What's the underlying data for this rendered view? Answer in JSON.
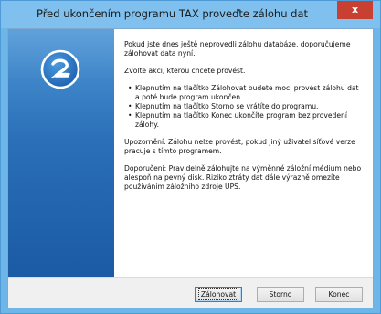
{
  "window": {
    "title": "Před ukončením programu TAX proveďte zálohu dat",
    "close_label": "x"
  },
  "sidebar": {
    "logo_icon": "tax-program-logo-icon"
  },
  "message": {
    "intro": "Pokud jste dnes ještě neprovedli zálohu databáze, doporučujeme zálohovat data nyní.",
    "choose": "Zvolte akci, kterou chcete provést.",
    "options": [
      "Klepnutím na tlačítko Zálohovat budete moci provést zálohu dat a poté bude program ukončen.",
      "Klepnutím na tlačítko Storno se vrátíte do programu.",
      "Klepnutím na tlačítko Konec ukončíte program bez provedení zálohy."
    ],
    "warning": "Upozornění: Zálohu nelze provést, pokud jiný uživatel síťové verze pracuje s tímto programem.",
    "recommendation": "Doporučení: Pravidelně zálohujte na výměnné záložní médium nebo alespoň na pevný disk. Riziko ztráty dat dále výrazně omezíte používáním záložního zdroje UPS."
  },
  "buttons": {
    "backup": {
      "label": "Zálohovat"
    },
    "cancel": {
      "label": "Storno"
    },
    "exit": {
      "label": "Konec"
    }
  },
  "colors": {
    "frame": "#6fb6e8",
    "titlebar": "#7fc0ee",
    "close": "#c84031",
    "sidebar": "#2a6fb8"
  }
}
